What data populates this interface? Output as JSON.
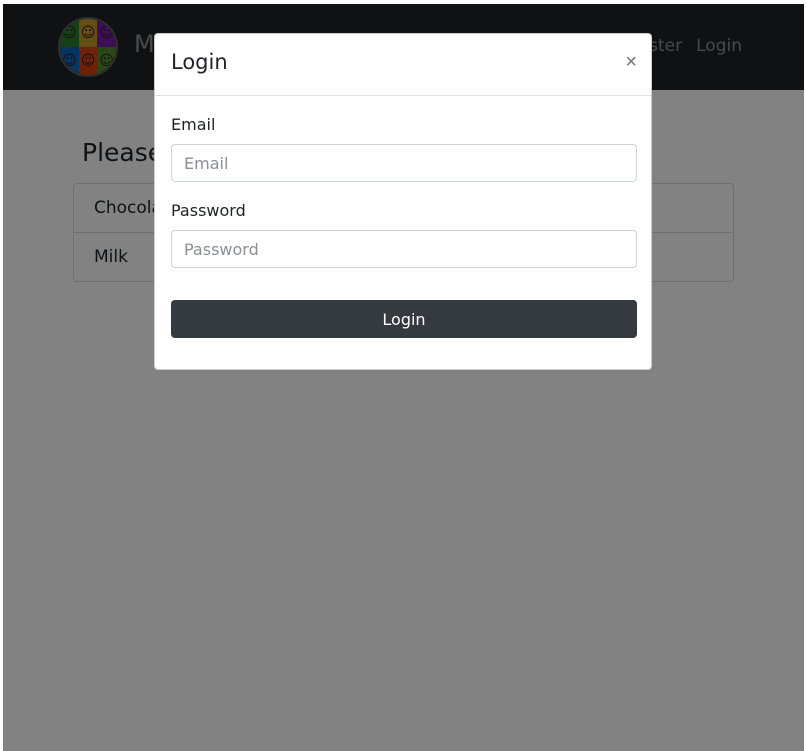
{
  "navbar": {
    "brand": "M",
    "links": [
      "Register",
      "Login"
    ],
    "avatar_icon": "face-collage-icon"
  },
  "page": {
    "title": "Please",
    "items": [
      "Chocola",
      "Milk"
    ]
  },
  "modal": {
    "title": "Login",
    "close_glyph": "×",
    "email_label": "Email",
    "email_placeholder": "Email",
    "email_value": "",
    "password_label": "Password",
    "password_placeholder": "Password",
    "password_value": "",
    "submit_label": "Login"
  },
  "colors": {
    "navbar": "#1e2226",
    "button": "#343a40",
    "backdrop": "rgba(0,0,0,0.49)"
  }
}
